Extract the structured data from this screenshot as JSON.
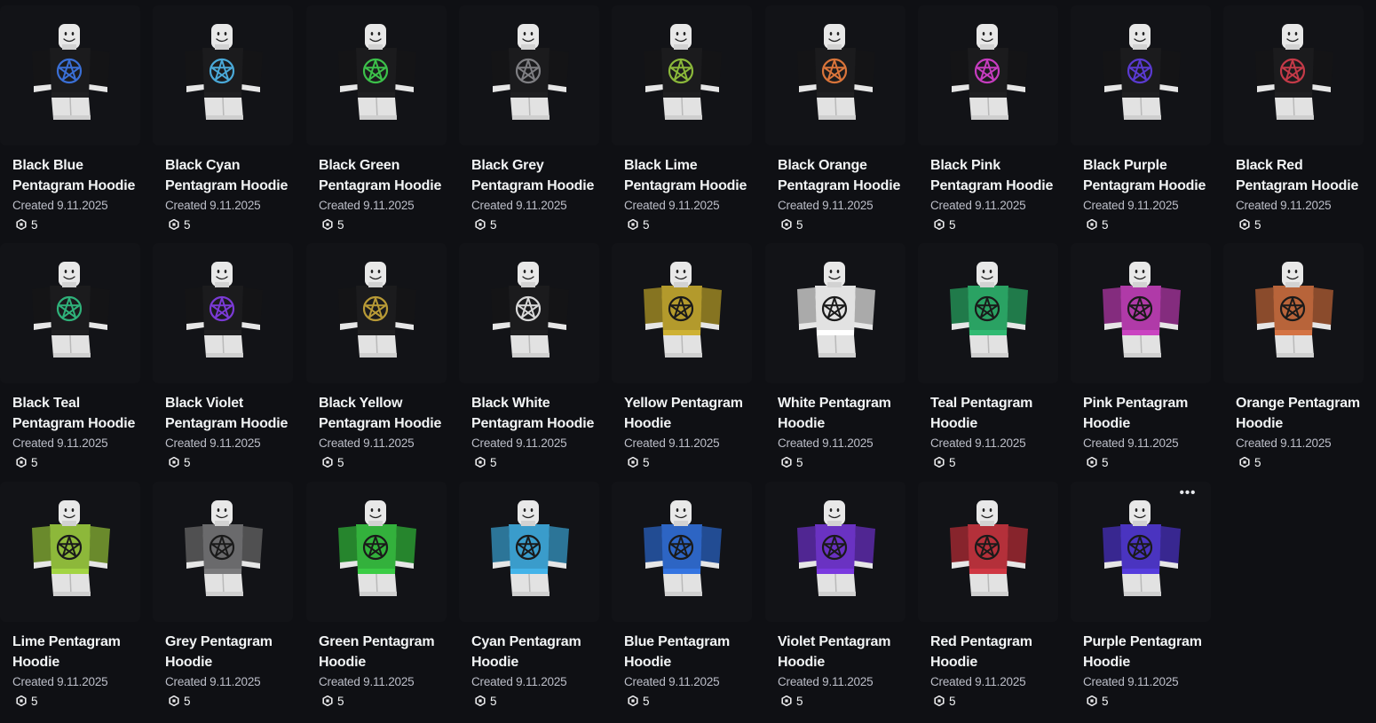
{
  "items": [
    {
      "name": "Black Blue Pentagram Hoodie",
      "created": "Created 9.11.2025",
      "price": "5",
      "shirt_color": "#1b1b1d",
      "symbol_color": "#3a6fd6"
    },
    {
      "name": "Black Cyan Pentagram Hoodie",
      "created": "Created 9.11.2025",
      "price": "5",
      "shirt_color": "#1b1b1d",
      "symbol_color": "#4aa9d8"
    },
    {
      "name": "Black Green Pentagram Hoodie",
      "created": "Created 9.11.2025",
      "price": "5",
      "shirt_color": "#1b1b1d",
      "symbol_color": "#3cc04a"
    },
    {
      "name": "Black Grey Pentagram Hoodie",
      "created": "Created 9.11.2025",
      "price": "5",
      "shirt_color": "#1b1b1d",
      "symbol_color": "#7e7e82"
    },
    {
      "name": "Black Lime Pentagram Hoodie",
      "created": "Created 9.11.2025",
      "price": "5",
      "shirt_color": "#1b1b1d",
      "symbol_color": "#8bb83a"
    },
    {
      "name": "Black Orange Pentagram Hoodie",
      "created": "Created 9.11.2025",
      "price": "5",
      "shirt_color": "#1b1b1d",
      "symbol_color": "#d9743a"
    },
    {
      "name": "Black Pink Pentagram Hoodie",
      "created": "Created 9.11.2025",
      "price": "5",
      "shirt_color": "#1b1b1d",
      "symbol_color": "#c63cbf"
    },
    {
      "name": "Black Purple Pentagram Hoodie",
      "created": "Created 9.11.2025",
      "price": "5",
      "shirt_color": "#1b1b1d",
      "symbol_color": "#5a3ad1"
    },
    {
      "name": "Black Red Pentagram Hoodie",
      "created": "Created 9.11.2025",
      "price": "5",
      "shirt_color": "#1b1b1d",
      "symbol_color": "#c43a48"
    },
    {
      "name": "Black Teal Pentagram Hoodie",
      "created": "Created 9.11.2025",
      "price": "5",
      "shirt_color": "#1b1b1d",
      "symbol_color": "#2fb27a"
    },
    {
      "name": "Black Violet Pentagram Hoodie",
      "created": "Created 9.11.2025",
      "price": "5",
      "shirt_color": "#1b1b1d",
      "symbol_color": "#7b3ad6"
    },
    {
      "name": "Black Yellow Pentagram Hoodie",
      "created": "Created 9.11.2025",
      "price": "5",
      "shirt_color": "#1b1b1d",
      "symbol_color": "#b89a36"
    },
    {
      "name": "Black White Pentagram Hoodie",
      "created": "Created 9.11.2025",
      "price": "5",
      "shirt_color": "#1b1b1d",
      "symbol_color": "#d8d8d8"
    },
    {
      "name": "Yellow Pentagram Hoodie",
      "created": "Created 9.11.2025",
      "price": "5",
      "shirt_color": "#b39a2c",
      "symbol_color": "#1a1a1a"
    },
    {
      "name": "White Pentagram Hoodie",
      "created": "Created 9.11.2025",
      "price": "5",
      "shirt_color": "#e2e2e2",
      "symbol_color": "#1a1a1a"
    },
    {
      "name": "Teal Pentagram Hoodie",
      "created": "Created 9.11.2025",
      "price": "5",
      "shirt_color": "#2aa263",
      "symbol_color": "#1a1a1a"
    },
    {
      "name": "Pink Pentagram Hoodie",
      "created": "Created 9.11.2025",
      "price": "5",
      "shirt_color": "#b03aa8",
      "symbol_color": "#1a1a1a"
    },
    {
      "name": "Orange Pentagram Hoodie",
      "created": "Created 9.11.2025",
      "price": "5",
      "shirt_color": "#b8643a",
      "symbol_color": "#1a1a1a"
    },
    {
      "name": "Lime Pentagram Hoodie",
      "created": "Created 9.11.2025",
      "price": "5",
      "shirt_color": "#8db83a",
      "symbol_color": "#1a1a1a"
    },
    {
      "name": "Grey Pentagram Hoodie",
      "created": "Created 9.11.2025",
      "price": "5",
      "shirt_color": "#6a6a6c",
      "symbol_color": "#1a1a1a"
    },
    {
      "name": "Green Pentagram Hoodie",
      "created": "Created 9.11.2025",
      "price": "5",
      "shirt_color": "#33b13c",
      "symbol_color": "#1a1a1a"
    },
    {
      "name": "Cyan Pentagram Hoodie",
      "created": "Created 9.11.2025",
      "price": "5",
      "shirt_color": "#3a9ccb",
      "symbol_color": "#1a1a1a"
    },
    {
      "name": "Blue Pentagram Hoodie",
      "created": "Created 9.11.2025",
      "price": "5",
      "shirt_color": "#2d65c4",
      "symbol_color": "#1a1a1a"
    },
    {
      "name": "Violet Pentagram Hoodie",
      "created": "Created 9.11.2025",
      "price": "5",
      "shirt_color": "#6a32c2",
      "symbol_color": "#1a1a1a"
    },
    {
      "name": "Red Pentagram Hoodie",
      "created": "Created 9.11.2025",
      "price": "5",
      "shirt_color": "#b4303a",
      "symbol_color": "#1a1a1a"
    },
    {
      "name": "Purple Pentagram Hoodie",
      "created": "Created 9.11.2025",
      "price": "5",
      "shirt_color": "#4a34c0",
      "symbol_color": "#1a1a1a",
      "show_more_menu": true
    }
  ],
  "more_menu_label": "•••",
  "currency_icon": "robux-icon"
}
